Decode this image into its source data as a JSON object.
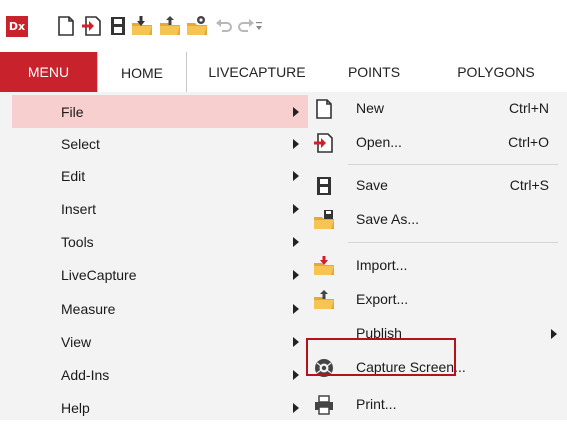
{
  "app": {
    "logo_text": "Dx",
    "accent": "#c8232c"
  },
  "quick_access": [
    {
      "icon": "new-file-icon"
    },
    {
      "icon": "open-file-icon"
    },
    {
      "icon": "save-icon"
    },
    {
      "icon": "save-as-icon"
    },
    {
      "icon": "export-icon"
    },
    {
      "icon": "publish-icon"
    },
    {
      "icon": "undo-icon"
    },
    {
      "icon": "redo-icon"
    },
    {
      "icon": "customize-dropdown-icon"
    }
  ],
  "tabs": {
    "menu": "MENU",
    "home": "HOME",
    "livecapture": "LIVECAPTURE",
    "points": "POINTS",
    "polygons": "POLYGONS"
  },
  "menu_left": [
    {
      "label": "File",
      "selected": true
    },
    {
      "label": "Select"
    },
    {
      "label": "Edit"
    },
    {
      "label": "Insert"
    },
    {
      "label": "Tools"
    },
    {
      "label": "LiveCapture"
    },
    {
      "label": "Measure"
    },
    {
      "label": "View"
    },
    {
      "label": "Add-Ins"
    },
    {
      "label": "Help"
    }
  ],
  "file_submenu": {
    "new": {
      "label": "New",
      "shortcut": "Ctrl+N",
      "icon": "new-document-icon"
    },
    "open": {
      "label": "Open...",
      "shortcut": "Ctrl+O",
      "icon": "open-icon"
    },
    "save": {
      "label": "Save",
      "shortcut": "Ctrl+S",
      "icon": "save-icon"
    },
    "save_as": {
      "label": "Save As...",
      "icon": "save-as-icon"
    },
    "import": {
      "label": "Import...",
      "icon": "import-icon",
      "highlighted": true
    },
    "export": {
      "label": "Export...",
      "icon": "export-icon"
    },
    "publish": {
      "label": "Publish"
    },
    "capture": {
      "label": "Capture Screen...",
      "icon": "camera-icon"
    },
    "print": {
      "label": "Print...",
      "icon": "printer-icon"
    }
  },
  "highlight_color": "#b5121b"
}
